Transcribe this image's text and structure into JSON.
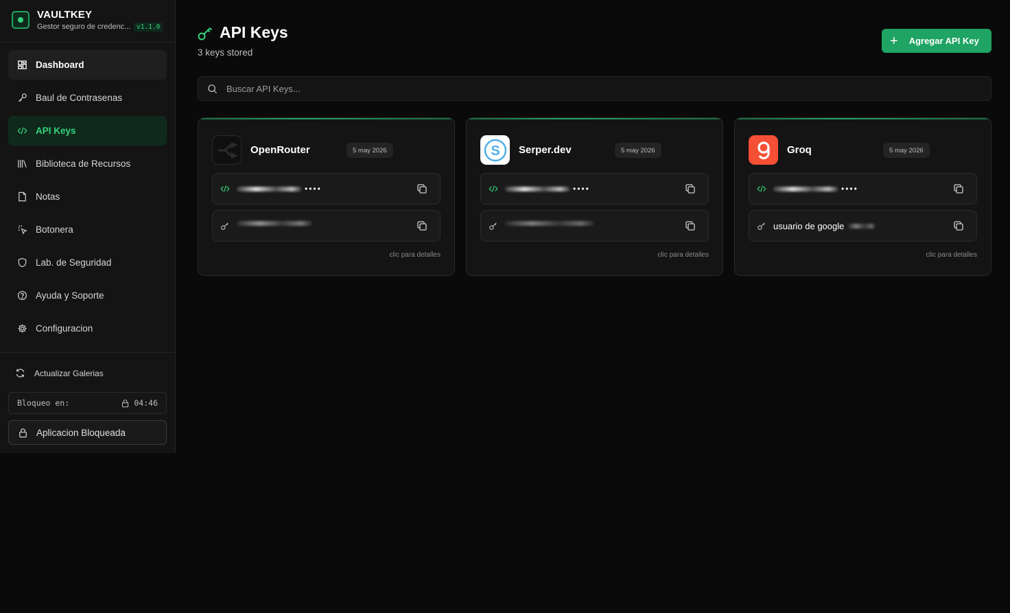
{
  "brand": {
    "title": "VAULTKEY",
    "subtitle": "Gestor seguro de credenc...",
    "version": "v1.1.0"
  },
  "nav": {
    "items": [
      {
        "label": "Dashboard",
        "icon": "dashboard-icon"
      },
      {
        "label": "Baul de Contrasenas",
        "icon": "key-icon"
      },
      {
        "label": "API Keys",
        "icon": "code-icon"
      },
      {
        "label": "Biblioteca de Recursos",
        "icon": "library-icon"
      },
      {
        "label": "Notas",
        "icon": "file-icon"
      },
      {
        "label": "Botonera",
        "icon": "pointer-icon"
      },
      {
        "label": "Lab. de Seguridad",
        "icon": "shield-icon"
      },
      {
        "label": "Ayuda y Soporte",
        "icon": "help-icon"
      },
      {
        "label": "Configuracion",
        "icon": "gear-icon"
      }
    ],
    "active": "API Keys"
  },
  "sidebar_footer": {
    "refresh_label": "Actualizar Galerias",
    "lock_label": "Bloqueo en:",
    "lock_time": "04:46",
    "lock_button": "Aplicacion Bloqueada"
  },
  "header": {
    "title": "API Keys",
    "subtitle": "3 keys stored",
    "add_button": "Agregar API Key"
  },
  "search": {
    "placeholder": "Buscar API Keys..."
  },
  "cards": [
    {
      "name": "OpenRouter",
      "date": "5 may 2026",
      "field1_masked": "••••",
      "field2_value": "",
      "hint": "clic para detalles"
    },
    {
      "name": "Serper.dev",
      "date": "5 may 2026",
      "field1_masked": "••••",
      "field2_value": "",
      "hint": "clic para detalles"
    },
    {
      "name": "Groq",
      "date": "5 may 2026",
      "field1_masked": "••••",
      "field2_value": "usuario de google",
      "hint": "clic para detalles"
    }
  ],
  "colors": {
    "accent": "#1fa463",
    "accent_text": "#34d27b",
    "background": "#0a0a0a",
    "sidebar": "#141414",
    "groq": "#f55036",
    "serper": "#4fb0e6"
  }
}
